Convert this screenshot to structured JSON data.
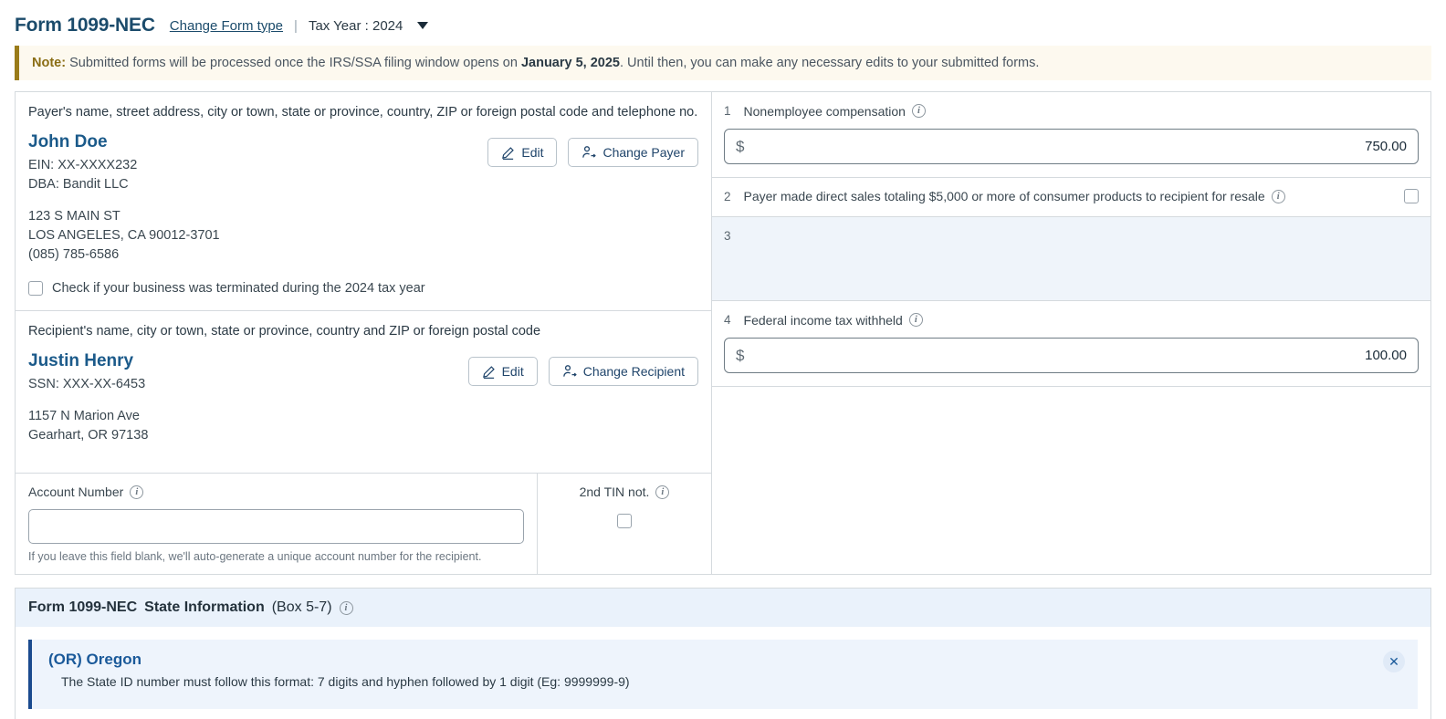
{
  "header": {
    "title": "Form 1099-NEC",
    "change_form_type": "Change Form type",
    "separator": "|",
    "tax_year": "Tax Year : 2024"
  },
  "note": {
    "label": "Note:",
    "text_before": " Submitted forms will be processed once the IRS/SSA filing window opens on ",
    "date": "January 5, 2025",
    "text_after": ". Until then, you can make any necessary edits to your submitted forms."
  },
  "payer": {
    "section_heading": "Payer's name, street address, city or town, state or province, country, ZIP or foreign postal code and telephone no.",
    "name": "John Doe",
    "ein": "EIN: XX-XXXX232",
    "dba": "DBA: Bandit LLC",
    "address1": "123 S MAIN ST",
    "address2": "LOS ANGELES, CA 90012-3701",
    "phone": "(085) 785-6586",
    "edit_label": "Edit",
    "change_label": "Change Payer",
    "terminated_checkbox_label": "Check if your business was terminated during the 2024 tax year"
  },
  "recipient": {
    "section_heading": "Recipient's name, city or town, state or province, country and ZIP or foreign postal code",
    "name": "Justin Henry",
    "ssn": "SSN: XXX-XX-6453",
    "address1": "1157 N Marion Ave",
    "address2": "Gearhart, OR 97138",
    "edit_label": "Edit",
    "change_label": "Change Recipient"
  },
  "account": {
    "label": "Account Number",
    "value": "",
    "placeholder": "",
    "hint": "If you leave this field blank, we'll auto-generate a unique account number for the recipient.",
    "tin_label": "2nd TIN not."
  },
  "boxes": [
    {
      "number": "1",
      "label": "Nonemployee compensation",
      "currency": "$",
      "amount": "750.00",
      "type": "money"
    },
    {
      "number": "2",
      "label": "Payer made direct sales totaling $5,000 or more of consumer products to recipient for resale",
      "type": "checkbox"
    },
    {
      "number": "3",
      "label": "",
      "type": "disabled"
    },
    {
      "number": "4",
      "label": "Federal income tax withheld",
      "currency": "$",
      "amount": "100.00",
      "type": "money"
    }
  ],
  "state_info": {
    "title_bold": "Form 1099-NEC",
    "title_rest": "State Information",
    "box_range": "(Box 5-7)",
    "alert": {
      "title": "(OR) Oregon",
      "message": "The State ID number must follow this format: 7 digits and hyphen followed by 1 digit (Eg: 9999999-9)",
      "close": "✕"
    }
  },
  "colors": {
    "accent_blue": "#1b5a8a",
    "header_blue": "#1b4b6b",
    "note_border": "#9a7c1a",
    "note_bg": "#fdf9ef",
    "alert_border": "#1b4b8f",
    "alert_bg": "#eef4fc",
    "state_head_bg": "#eaf2fb",
    "disabled_bg": "#eff4fa"
  },
  "icons": {
    "pencil": "pencil-icon",
    "person_switch": "person-switch-icon",
    "info": "info-icon",
    "caret_down": "chevron-down-icon",
    "close": "close-icon"
  }
}
